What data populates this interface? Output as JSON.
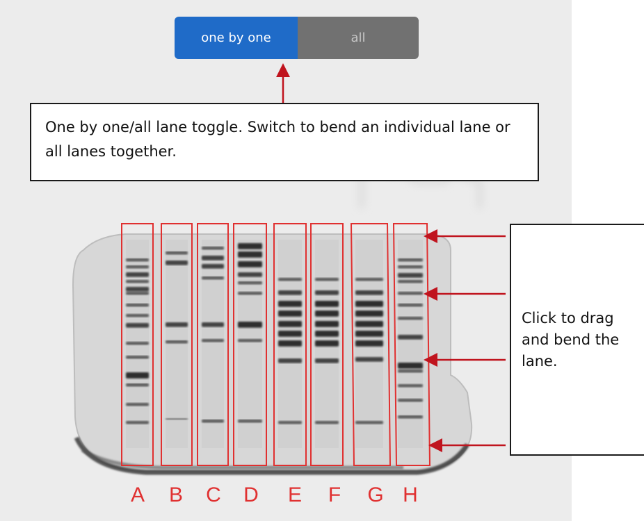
{
  "toggle": {
    "one_by_one_label": "one by one",
    "all_label": "all",
    "selected": "one by one"
  },
  "callouts": {
    "toggle_note": "One by one/all lane toggle. Switch to bend an individual lane or all lanes together.",
    "drag_note": "Click to drag and bend the lane."
  },
  "lanes": [
    "A",
    "B",
    "C",
    "D",
    "E",
    "F",
    "G",
    "H"
  ],
  "colors": {
    "toggle_active": "#1f6bc8",
    "toggle_inactive": "#717171",
    "lane_box": "#e03030",
    "arrow": "#c0141e"
  }
}
